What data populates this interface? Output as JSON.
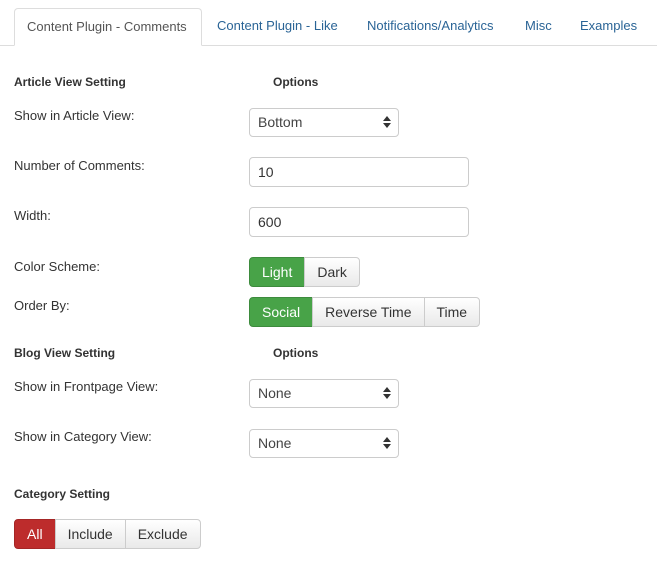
{
  "tabs": [
    {
      "label": "Content Plugin - Comments",
      "active": true
    },
    {
      "label": "Content Plugin - Like",
      "active": false
    },
    {
      "label": "Notifications/Analytics",
      "active": false
    },
    {
      "label": "Misc",
      "active": false
    },
    {
      "label": "Examples",
      "active": false
    }
  ],
  "article_view": {
    "heading": "Article View Setting",
    "options_heading": "Options",
    "show_in_article_view": {
      "label": "Show in Article View:",
      "value": "Bottom"
    },
    "number_of_comments": {
      "label": "Number of Comments:",
      "value": "10"
    },
    "width": {
      "label": "Width:",
      "value": "600"
    },
    "color_scheme": {
      "label": "Color Scheme:",
      "options": [
        "Light",
        "Dark"
      ],
      "selected": "Light"
    },
    "order_by": {
      "label": "Order By:",
      "options": [
        "Social",
        "Reverse Time",
        "Time"
      ],
      "selected": "Social"
    }
  },
  "blog_view": {
    "heading": "Blog View Setting",
    "options_heading": "Options",
    "show_in_frontpage_view": {
      "label": "Show in Frontpage View:",
      "value": "None"
    },
    "show_in_category_view": {
      "label": "Show in Category View:",
      "value": "None"
    }
  },
  "category": {
    "heading": "Category Setting",
    "options": [
      "All",
      "Include",
      "Exclude"
    ],
    "selected": "All"
  },
  "colors": {
    "active_green": "#48a348",
    "active_red": "#bd2c2c",
    "tab_link": "#2a6496"
  }
}
